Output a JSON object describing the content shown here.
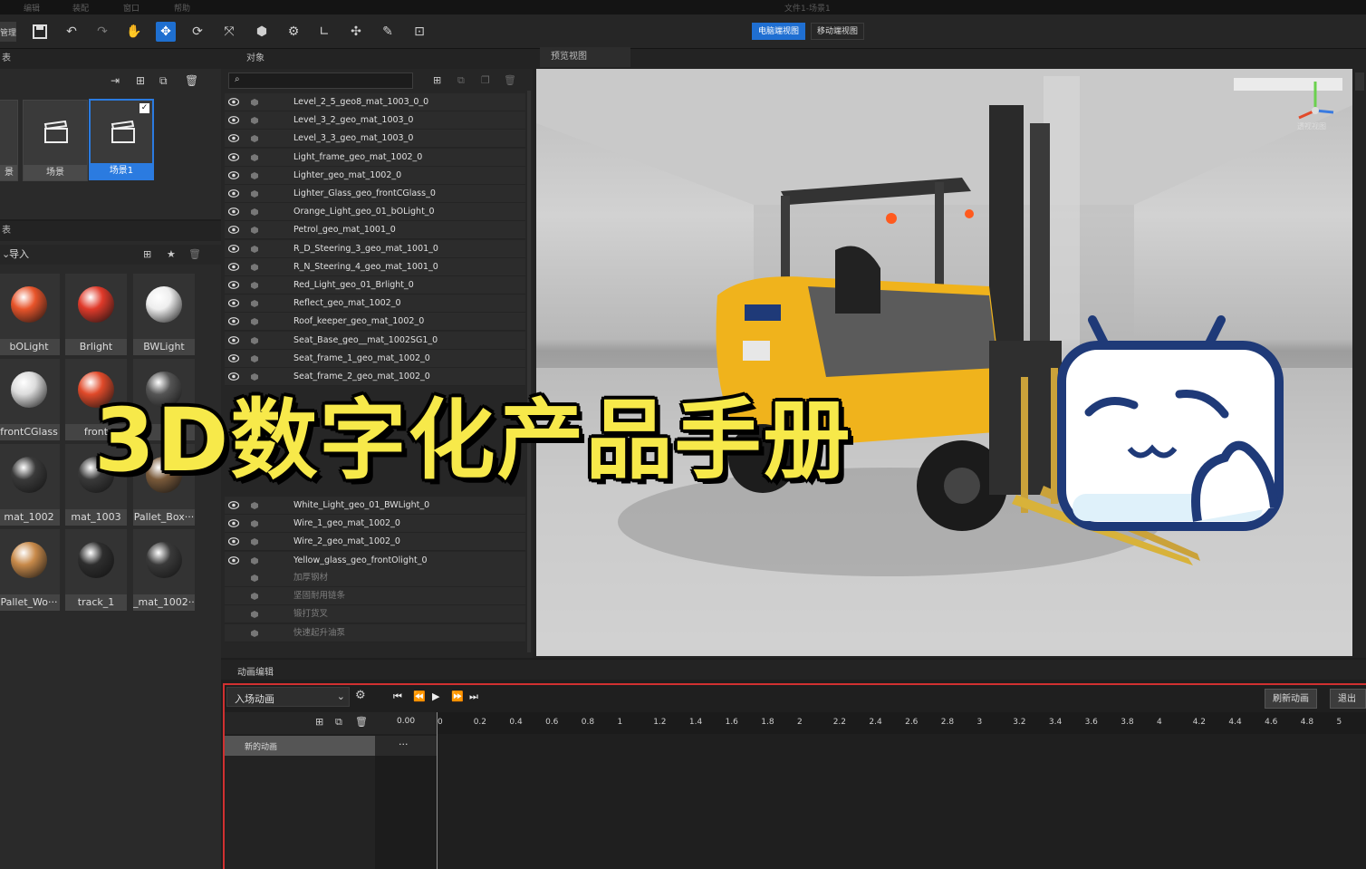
{
  "menu": [
    "编辑",
    "装配",
    "窗口",
    "帮助"
  ],
  "window_title": "文件1-场景1",
  "toolbar_left_label": "管理",
  "view_modes": [
    "电脑端视图",
    "移动端视图"
  ],
  "panels": {
    "scene_title": "表",
    "material_title": "表",
    "material_filter": "导入",
    "object_title": "对象",
    "preview_title": "预览视图",
    "animation_title": "动画编辑"
  },
  "scenes": [
    "景",
    "场景",
    "场景1"
  ],
  "selected_scene_check": "✓",
  "materials": [
    {
      "name": "bOLight",
      "color": "#e8542a"
    },
    {
      "name": "Brlight",
      "color": "#e03a2a"
    },
    {
      "name": "BWLight",
      "color": "#eeeeee"
    },
    {
      "name": "frontCGlass",
      "color": "#dcdcdc"
    },
    {
      "name": "front",
      "color": "#e04a2a"
    },
    {
      "name": "",
      "color": "#555555"
    },
    {
      "name": "mat_1002",
      "color": "#3a3a3a"
    },
    {
      "name": "mat_1003",
      "color": "#3a3a3a"
    },
    {
      "name": "Pallet_Box···",
      "color": "#7a5a3a"
    },
    {
      "name": "Pallet_Wo···",
      "color": "#c88a4a"
    },
    {
      "name": "track_1",
      "color": "#2e2e2e"
    },
    {
      "name": "_mat_1002···",
      "color": "#3a3a3a"
    }
  ],
  "objects": [
    "Level_2_5_geo8_mat_1003_0_0",
    "Level_3_2_geo_mat_1003_0",
    "Level_3_3_geo_mat_1003_0",
    "Light_frame_geo_mat_1002_0",
    "Lighter_geo_mat_1002_0",
    "Lighter_Glass_geo_frontCGlass_0",
    "Orange_Light_geo_01_bOLight_0",
    "Petrol_geo_mat_1001_0",
    "R_D_Steering_3_geo_mat_1001_0",
    "R_N_Steering_4_geo_mat_1001_0",
    "Red_Light_geo_01_Brlight_0",
    "Reflect_geo_mat_1002_0",
    "Roof_keeper_geo_mat_1002_0",
    "Seat_Base_geo__mat_1002SG1_0",
    "Seat_frame_1_geo_mat_1002_0",
    "Seat_frame_2_geo_mat_1002_0"
  ],
  "objects_lower": [
    "White_Light_geo_01_BWLight_0",
    "Wire_1_geo_mat_1002_0",
    "Wire_2_geo_mat_1002_0",
    "Yellow_glass_geo_frontOlight_0"
  ],
  "object_groups": [
    "加厚钢材",
    "坚固耐用链条",
    "锻打货叉",
    "快速起升油泵"
  ],
  "viewport": {
    "cube_label": "透视视图"
  },
  "headline": "3D数字化产品手册",
  "timeline": {
    "animation_select": "入场动画",
    "time_value": "0.00",
    "track_label": "新的动画",
    "track_more": "···",
    "refresh_button": "刷新动画",
    "exit_button": "退出动",
    "ticks": [
      "0",
      "0.2",
      "0.4",
      "0.6",
      "0.8",
      "1",
      "1.2",
      "1.4",
      "1.6",
      "1.8",
      "2",
      "2.2",
      "2.4",
      "2.6",
      "2.8",
      "3",
      "3.2",
      "3.4",
      "3.6",
      "3.8",
      "4",
      "4.2",
      "4.4",
      "4.6",
      "4.8",
      "5"
    ]
  },
  "colors": {
    "accent": "#1e6fd0",
    "timeline_border": "#d03030",
    "headline": "#f7e94a"
  }
}
